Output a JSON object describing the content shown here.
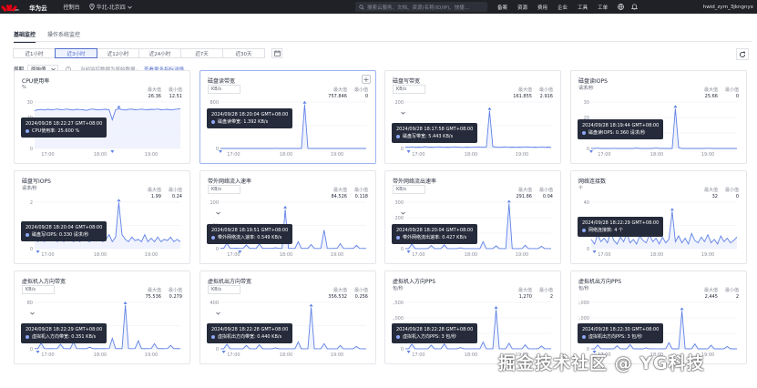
{
  "topbar": {
    "logo_sub": "HUAWEI",
    "brand": "华为云",
    "console": "控制台",
    "region": "华北-北京四",
    "search_placeholder": "搜索云服务、文档、资源(名称/ID/IP)、快捷...",
    "right_items": [
      "备案",
      "资源",
      "费用",
      "企业",
      "工具",
      "工单"
    ],
    "user": "hwid_zym_3jkngnyx"
  },
  "tabs": [
    {
      "label": "基础监控",
      "active": true
    },
    {
      "label": "操作系统监控",
      "active": false
    }
  ],
  "ranges": [
    {
      "label": "近1小时",
      "active": false
    },
    {
      "label": "近3小时",
      "active": true
    },
    {
      "label": "近12小时",
      "active": false
    },
    {
      "label": "近24小时",
      "active": false
    },
    {
      "label": "近7天",
      "active": false
    },
    {
      "label": "近30天",
      "active": false
    }
  ],
  "period": {
    "label": "周期",
    "value": "原始值",
    "hint": "当前监控数据为原始数据。",
    "link": "查看更多指标详情"
  },
  "colors": {
    "line": "#5f81e6",
    "fill": "#e9eefc",
    "accent": "#526ecc"
  },
  "cards": [
    {
      "title": "CPU使用率",
      "unit": "%",
      "select": null,
      "stats": {
        "max_label": "最大值",
        "max": "26.36",
        "min_label": "最小值",
        "min": "12.51"
      },
      "tooltip": {
        "time": "2024/09/28 18:22:27 GMT+08:00",
        "item": "CPU使用率: 25.600 %"
      },
      "plus": false,
      "selected": false,
      "chart_data": {
        "type": "line",
        "ylim": [
          0,
          30
        ],
        "yticks": [
          "30",
          "20",
          "10",
          "0"
        ],
        "xticks": [
          "17:00",
          "18:00",
          "19:00"
        ],
        "xtick_pos": [
          0.09,
          0.45,
          0.8
        ],
        "values": [
          24.5,
          25,
          25.2,
          24.8,
          25.3,
          25,
          25.1,
          25.5,
          25,
          25.2,
          25.4,
          25,
          24.8,
          25.3,
          25.1,
          25,
          24.6,
          25.2,
          25.5,
          25,
          24.9,
          25.2,
          25.3,
          25,
          18.5,
          25,
          25.6,
          25.1,
          24.8,
          25.3,
          25.4,
          25,
          25.2,
          25.4,
          25.1,
          25,
          25.3,
          25.2,
          25.5,
          25,
          25.1,
          25.3,
          24.9,
          25.2,
          25.4,
          25.6
        ]
      }
    },
    {
      "title": "磁盘读带宽",
      "unit": null,
      "select": "KB/s",
      "stats": {
        "max_label": "最大值",
        "max": "757.846",
        "min_label": "最小值",
        "min": "0"
      },
      "tooltip": {
        "time": "2024/09/28 18:20:04 GMT+08:00",
        "item": "磁盘读带宽: 1.392 KB/s"
      },
      "plus": true,
      "selected": true,
      "chart_data": {
        "type": "line",
        "ylim": [
          0,
          800
        ],
        "yticks": [
          "800",
          "400",
          "0"
        ],
        "xticks": [
          "17:00",
          "18:00",
          "19:00"
        ],
        "xtick_pos": [
          0.09,
          0.45,
          0.8
        ],
        "values": [
          0,
          0,
          2,
          0,
          0,
          0,
          0,
          0,
          1,
          0,
          0,
          0,
          0,
          0,
          0,
          0,
          0,
          3,
          0,
          0,
          0,
          0,
          0,
          0,
          0,
          0,
          757.8,
          2,
          0,
          0,
          0,
          0,
          0,
          0,
          0,
          1,
          0,
          0,
          0,
          0,
          0,
          0,
          0,
          0,
          0,
          0
        ]
      }
    },
    {
      "title": "磁盘写带宽",
      "unit": null,
      "select": "KB/s",
      "stats": {
        "max_label": "最大值",
        "max": "161.855",
        "min_label": "最小值",
        "min": "2.916"
      },
      "tooltip": {
        "time": "2024/09/28 18:17:58 GMT+08:00",
        "item": "磁盘写带宽: 5.443 KB/s"
      },
      "plus": false,
      "selected": false,
      "chart_data": {
        "type": "line",
        "ylim": [
          0,
          200
        ],
        "yticks": [
          "200",
          "100",
          "0"
        ],
        "xticks": [
          "17:00",
          "18:00",
          "19:00"
        ],
        "xtick_pos": [
          0.09,
          0.45,
          0.8
        ],
        "values": [
          6,
          5,
          7,
          5,
          6,
          5,
          8,
          5,
          6,
          5,
          7,
          6,
          5,
          6,
          5,
          7,
          6,
          5,
          5,
          6,
          5,
          5.4,
          6,
          7,
          5,
          6,
          161.9,
          8,
          6,
          5,
          6,
          7,
          5,
          6,
          5,
          6,
          5,
          7,
          6,
          5,
          6,
          5,
          7,
          5,
          6,
          5
        ]
      }
    },
    {
      "title": "磁盘读IOPS",
      "unit": "请求/秒",
      "select": null,
      "stats": {
        "max_label": "最大值",
        "max": "25.66",
        "min_label": "最小值",
        "min": "0"
      },
      "tooltip": {
        "time": "2024/09/28 18:19:44 GMT+08:00",
        "item": "磁盘读IOPS: 0.360 请求/秒"
      },
      "plus": false,
      "selected": false,
      "chart_data": {
        "type": "line",
        "ylim": [
          0,
          30
        ],
        "yticks": [
          "30",
          "20",
          "10",
          "0"
        ],
        "xticks": [
          "17:00",
          "18:00",
          "19:00"
        ],
        "xtick_pos": [
          0.09,
          0.45,
          0.8
        ],
        "values": [
          0,
          0,
          0.2,
          0,
          0,
          0,
          0,
          0.1,
          0,
          0,
          0,
          0,
          0,
          0,
          0.3,
          0,
          0,
          0,
          0,
          0,
          0.36,
          0,
          0,
          0,
          0,
          0,
          25.7,
          0.5,
          0,
          0,
          0,
          0,
          0,
          0,
          0,
          0,
          0.2,
          0,
          0,
          0,
          0,
          0,
          0,
          0,
          0,
          0
        ]
      }
    },
    {
      "title": "磁盘写IOPS",
      "unit": "请求/秒",
      "select": null,
      "stats": {
        "max_label": "最大值",
        "max": "1.99",
        "min_label": "最小值",
        "min": "0.24"
      },
      "tooltip": {
        "time": "2024/09/28 18:20:04 GMT+08:00",
        "item": "磁盘写IOPS: 0.330 请求/秒"
      },
      "plus": false,
      "selected": false,
      "chart_data": {
        "type": "line",
        "ylim": [
          0,
          2
        ],
        "yticks": [
          "2",
          "1",
          "0"
        ],
        "xticks": [
          "17:00",
          "18:00",
          "19:00"
        ],
        "xtick_pos": [
          0.09,
          0.45,
          0.8
        ],
        "values": [
          0.4,
          0.3,
          0.5,
          0.3,
          0.6,
          0.35,
          0.4,
          0.3,
          0.5,
          0.3,
          0.45,
          0.6,
          0.3,
          0.4,
          0.3,
          0.5,
          0.35,
          0.3,
          0.4,
          0.33,
          0.5,
          0.3,
          0.4,
          0.6,
          0.3,
          0.5,
          1.99,
          0.6,
          0.4,
          0.3,
          0.5,
          0.35,
          0.4,
          0.3,
          0.6,
          0.3,
          0.45,
          0.3,
          0.5,
          0.3,
          0.4,
          0.35,
          0.5,
          0.3,
          0.4,
          0.3
        ]
      }
    },
    {
      "title": "带外网络流入速率",
      "unit": null,
      "select": "KB/s",
      "stats": {
        "max_label": "最大值",
        "max": "84.526",
        "min_label": "最小值",
        "min": "0.118"
      },
      "tooltip": {
        "time": "2024/09/28 18:19:51 GMT+08:00",
        "item": "带外网络流入速率: 0.549 KB/s"
      },
      "plus": false,
      "selected": false,
      "chart_data": {
        "type": "line",
        "ylim": [
          0,
          100
        ],
        "yticks": [
          "100",
          "50",
          "0"
        ],
        "xticks": [
          "17:00",
          "18:00",
          "19:00"
        ],
        "xtick_pos": [
          0.09,
          0.45,
          0.8
        ],
        "values": [
          1,
          0.5,
          12,
          0.6,
          0.5,
          1,
          0.4,
          0.5,
          8,
          0.6,
          0.5,
          0.4,
          10,
          0.5,
          0.6,
          0.5,
          0.4,
          2,
          0.55,
          0.5,
          84.5,
          0.6,
          0.5,
          0.4,
          15,
          0.5,
          0.6,
          0.5,
          9,
          0.5,
          0.4,
          0.6,
          40,
          0.5,
          0.4,
          0.6,
          0.5,
          11,
          0.5,
          0.4,
          0.6,
          0.5,
          7,
          0.5,
          0.4,
          0.6
        ]
      }
    },
    {
      "title": "带外网络流出速率",
      "unit": null,
      "select": "KB/s",
      "stats": {
        "max_label": "最大值",
        "max": "291.86",
        "min_label": "最小值",
        "min": "0.04"
      },
      "tooltip": {
        "time": "2024/09/28 18:20:04 GMT+08:00",
        "item": "带外网络流出速率: 0.427 KB/s"
      },
      "plus": false,
      "selected": false,
      "chart_data": {
        "type": "line",
        "ylim": [
          0,
          300
        ],
        "yticks": [
          "300",
          "200",
          "100",
          "0"
        ],
        "xticks": [
          "17:00",
          "18:00",
          "19:00"
        ],
        "xtick_pos": [
          0.09,
          0.45,
          0.8
        ],
        "values": [
          0.5,
          0.4,
          30,
          0.5,
          0.4,
          0.5,
          0.4,
          0.5,
          20,
          0.5,
          0.4,
          0.4,
          25,
          0.5,
          0.4,
          0.5,
          0.4,
          5,
          0.4,
          0.5,
          0.43,
          0.5,
          0.4,
          0.5,
          45,
          0.4,
          0.5,
          0.4,
          18,
          0.5,
          0.4,
          0.5,
          291.9,
          0.4,
          0.5,
          0.4,
          0.5,
          22,
          0.4,
          0.5,
          0.4,
          0.5,
          15,
          0.4,
          0.5,
          0.4
        ]
      }
    },
    {
      "title": "网络连接数",
      "unit": "个",
      "select": null,
      "stats": {
        "max_label": "最大值",
        "max": "32",
        "min_label": "最小值",
        "min": "0"
      },
      "tooltip": {
        "time": "2024/09/28 18:22:29 GMT+08:00",
        "item": "网络连接数: 4 个"
      },
      "plus": false,
      "selected": false,
      "chart_data": {
        "type": "line",
        "ylim": [
          0,
          40
        ],
        "yticks": [
          "40",
          "20",
          "0"
        ],
        "xticks": [
          "17:00",
          "18:00",
          "19:00"
        ],
        "xtick_pos": [
          0.09,
          0.45,
          0.8
        ],
        "values": [
          8,
          4,
          12,
          6,
          9,
          5,
          14,
          7,
          4,
          10,
          6,
          13,
          5,
          8,
          4,
          11,
          7,
          5,
          12,
          6,
          9,
          4,
          10,
          5,
          8,
          32,
          6,
          11,
          5,
          9,
          4,
          13,
          7,
          5,
          10,
          6,
          12,
          5,
          8,
          4,
          11,
          6,
          9,
          5,
          7,
          10
        ]
      }
    },
    {
      "title": "虚拟机入方向带宽",
      "unit": null,
      "select": "KB/s",
      "stats": {
        "max_label": "最大值",
        "max": "75.536",
        "min_label": "最小值",
        "min": "0.279"
      },
      "tooltip": {
        "time": "2024/09/28 18:22:29 GMT+08:00",
        "item": "虚拟机入方向带宽: 0.351 KB/s"
      },
      "plus": false,
      "selected": false,
      "chart_data": {
        "type": "line",
        "ylim": [
          0,
          80
        ],
        "yticks": [
          "80",
          "40",
          "0"
        ],
        "xticks": [
          "17:00",
          "18:00",
          "19:00"
        ],
        "xtick_pos": [
          0.09,
          0.45,
          0.8
        ],
        "values": [
          0.4,
          0.3,
          10,
          0.4,
          0.3,
          0.4,
          0.3,
          0.4,
          8,
          0.4,
          0.3,
          0.3,
          12,
          0.4,
          0.3,
          0.4,
          0.3,
          3,
          0.3,
          0.4,
          0.35,
          0.4,
          0.3,
          0.4,
          18,
          0.3,
          0.4,
          0.3,
          75.5,
          0.4,
          0.3,
          0.4,
          14,
          0.3,
          0.4,
          0.3,
          0.4,
          9,
          0.3,
          0.4,
          0.3,
          0.4,
          6,
          0.3,
          0.4,
          0.3
        ]
      }
    },
    {
      "title": "虚拟机出方向带宽",
      "unit": null,
      "select": "KB/s",
      "stats": {
        "max_label": "最大值",
        "max": "356.532",
        "min_label": "最小值",
        "min": "0.256"
      },
      "tooltip": {
        "time": "2024/09/28 18:22:28 GMT+08:00",
        "item": "虚拟机出方向带宽: 0.440 KB/s"
      },
      "plus": false,
      "selected": false,
      "chart_data": {
        "type": "line",
        "ylim": [
          0,
          400
        ],
        "yticks": [
          "400",
          "200",
          "0"
        ],
        "xticks": [
          "17:00",
          "18:00",
          "19:00"
        ],
        "xtick_pos": [
          0.09,
          0.45,
          0.8
        ],
        "values": [
          0.5,
          0.4,
          40,
          0.5,
          0.4,
          0.5,
          0.4,
          0.5,
          30,
          0.5,
          0.4,
          0.4,
          35,
          0.5,
          0.4,
          0.5,
          0.4,
          8,
          0.4,
          0.5,
          0.44,
          0.5,
          0.4,
          0.5,
          60,
          0.4,
          0.5,
          0.4,
          356.5,
          0.5,
          0.4,
          0.5,
          45,
          0.4,
          0.5,
          0.4,
          0.5,
          28,
          0.4,
          0.5,
          0.4,
          0.5,
          20,
          0.4,
          0.5,
          0.4
        ]
      }
    },
    {
      "title": "虚拟机入方向PPS",
      "unit": "包/秒",
      "select": null,
      "stats": {
        "max_label": "最大值",
        "max": "1,270",
        "min_label": "最小值",
        "min": "2"
      },
      "tooltip": {
        "time": "2024/09/28 18:22:28 GMT+08:00",
        "item": "虚拟机入方向PPS: 3 包/秒"
      },
      "plus": false,
      "selected": false,
      "chart_data": {
        "type": "line",
        "ylim": [
          0,
          1500
        ],
        "yticks": [
          "1,500",
          "1,000",
          "500",
          "0"
        ],
        "xticks": [
          "17:00",
          "18:00",
          "19:00"
        ],
        "xtick_pos": [
          0.09,
          0.45,
          0.8
        ],
        "values": [
          3,
          2,
          150,
          3,
          2,
          3,
          2,
          3,
          120,
          3,
          2,
          2,
          160,
          3,
          2,
          3,
          2,
          40,
          2,
          3,
          3,
          3,
          2,
          3,
          220,
          2,
          3,
          2,
          1270,
          3,
          2,
          3,
          180,
          2,
          3,
          2,
          3,
          130,
          2,
          3,
          2,
          3,
          90,
          2,
          3,
          2
        ]
      }
    },
    {
      "title": "虚拟机出方向PPS",
      "unit": "包/秒",
      "select": null,
      "stats": {
        "max_label": "最大值",
        "max": "2,445",
        "min_label": "最小值",
        "min": "2"
      },
      "tooltip": {
        "time": "2024/09/28 18:22:30 GMT+08:00",
        "item": "虚拟机出方向PPS: 3 包/秒"
      },
      "plus": false,
      "selected": false,
      "chart_data": {
        "type": "line",
        "ylim": [
          0,
          3000
        ],
        "yticks": [
          "3,000",
          "2,000",
          "1,000",
          "0"
        ],
        "xticks": [
          "17:00",
          "18:00",
          "19:00"
        ],
        "xtick_pos": [
          0.09,
          0.45,
          0.8
        ],
        "values": [
          3,
          2,
          250,
          3,
          2,
          3,
          2,
          3,
          200,
          3,
          2,
          2,
          280,
          3,
          2,
          3,
          2,
          60,
          2,
          3,
          3,
          3,
          2,
          3,
          400,
          2,
          3,
          2,
          2445,
          3,
          2,
          3,
          320,
          2,
          3,
          2,
          3,
          230,
          2,
          3,
          2,
          3,
          150,
          2,
          3,
          2
        ]
      }
    }
  ],
  "watermark": "掘金技术社区 @ YG科技"
}
